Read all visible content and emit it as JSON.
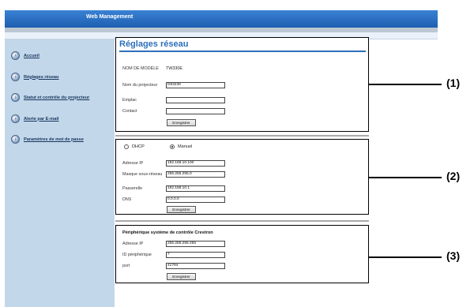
{
  "header": {
    "title": "Web Management"
  },
  "sidebar": {
    "items": [
      {
        "label": "Accueil"
      },
      {
        "label": "Réglages réseau"
      },
      {
        "label": "Statut et contrôle du projecteur"
      },
      {
        "label": "Alerte par E-mail"
      },
      {
        "label": "Paramètres de mot de passe"
      }
    ]
  },
  "panel1": {
    "title": "Réglages réseau",
    "model_label": "NOM DE MODÈLE",
    "model_value": "TW330E",
    "projector_label": "Nom du projecteur",
    "projector_value": "D63238",
    "location_label": "Emplac",
    "location_value": "",
    "contact_label": "Contact",
    "contact_value": "",
    "save_label": "Enregistrer"
  },
  "panel2": {
    "dhcp_label": "DHCP",
    "manual_label": "Manuel",
    "selected": "Manuel",
    "ip_label": "Adresse IP",
    "ip_value": "192.168.10.100",
    "mask_label": "Masque sous-réseau",
    "mask_value": "255.255.255.0",
    "gateway_label": "Passerelle",
    "gateway_value": "192.168.10.1",
    "dns_label": "DNS",
    "dns_value": "0.0.0.0",
    "save_label": "Enregistrer"
  },
  "panel3": {
    "title": "Périphérique système de contrôle Crestron",
    "ip_label": "Adresse IP",
    "ip_value": "255.255.255.255",
    "device_label": "ID périphérique",
    "device_value": "7",
    "port_label": "port",
    "port_value": "41794",
    "save_label": "Enregistrer"
  },
  "callouts": [
    "(1)",
    "(2)",
    "(3)"
  ]
}
